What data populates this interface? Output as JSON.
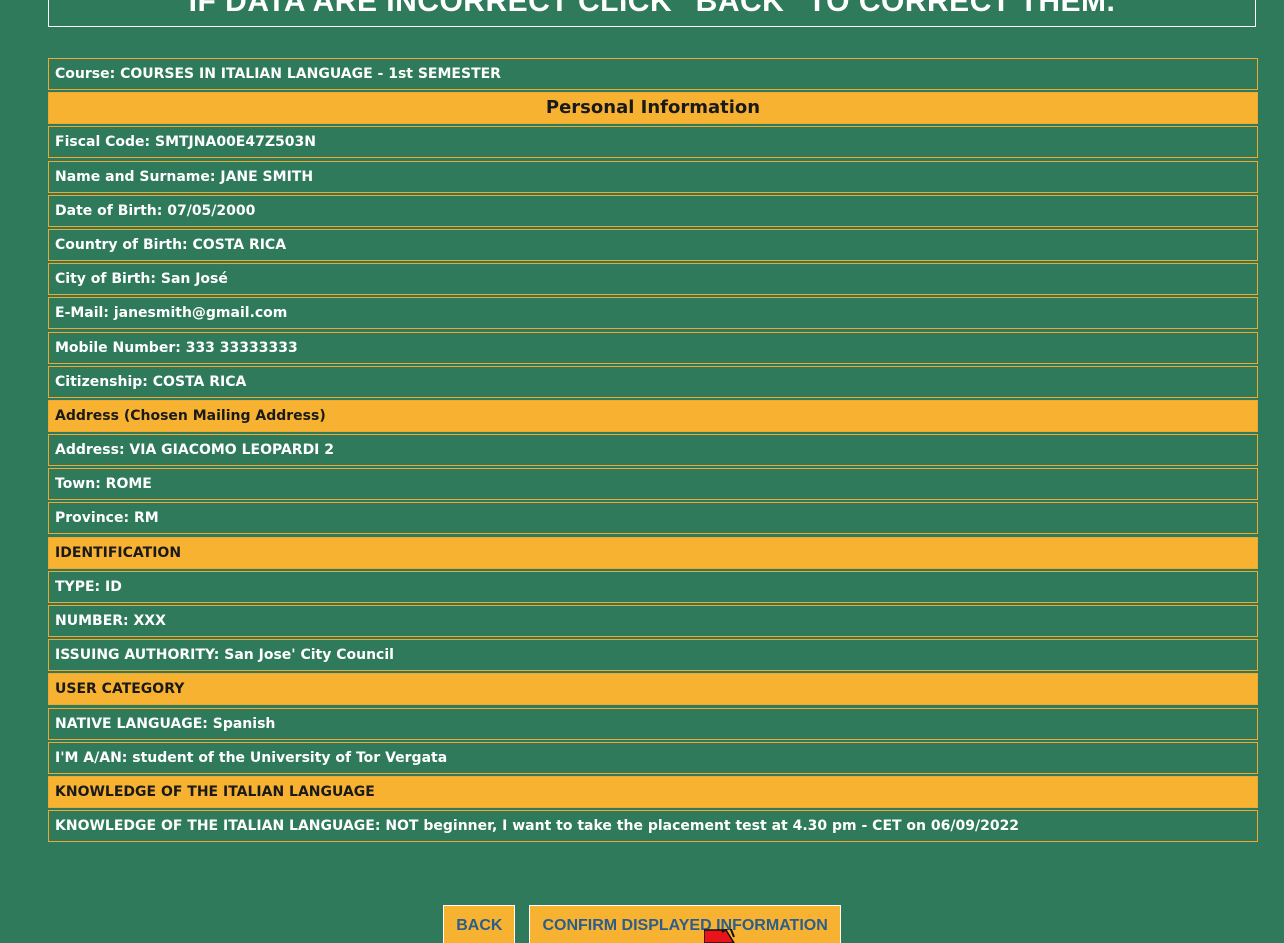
{
  "banner": {
    "text": "IF DATA ARE INCORRECT CLICK \"BACK\" TO CORRECT THEM."
  },
  "rows": {
    "course": "Course: COURSES IN ITALIAN LANGUAGE - 1st SEMESTER",
    "personal_header": "Personal Information",
    "fiscal_code": "Fiscal Code: SMTJNA00E47Z503N",
    "name": "Name and Surname: JANE SMITH",
    "dob": "Date of Birth: 07/05/2000",
    "country_birth": "Country of Birth: COSTA RICA",
    "city_birth": "City of Birth: San José",
    "email": "E-Mail: janesmith@gmail.com",
    "mobile": "Mobile Number: 333 33333333",
    "citizenship": "Citizenship: COSTA RICA",
    "address_header": "Address (Chosen Mailing Address)",
    "address": "Address: VIA GIACOMO LEOPARDI 2",
    "town": "Town: ROME",
    "province": "Province: RM",
    "identification_header": "IDENTIFICATION",
    "id_type": "TYPE: ID",
    "id_number": "NUMBER: XXX",
    "issuing_authority": "ISSUING AUTHORITY: San Jose' City Council",
    "user_category_header": "USER CATEGORY",
    "native_language": "NATIVE LANGUAGE: Spanish",
    "iam": "I'M A/AN: student of the University of Tor Vergata",
    "knowledge_header": "KNOWLEDGE OF THE ITALIAN LANGUAGE",
    "knowledge": "KNOWLEDGE OF THE ITALIAN LANGUAGE: NOT beginner, I want to take the placement test at 4.30 pm - CET on 06/09/2022"
  },
  "buttons": {
    "back": "BACK",
    "confirm": "CONFIRM DISPLAYED INFORMATION"
  },
  "colors": {
    "background": "#2e7a5b",
    "highlight": "#f7b231",
    "border": "#f0a830",
    "button_text": "#2b5e8a"
  }
}
